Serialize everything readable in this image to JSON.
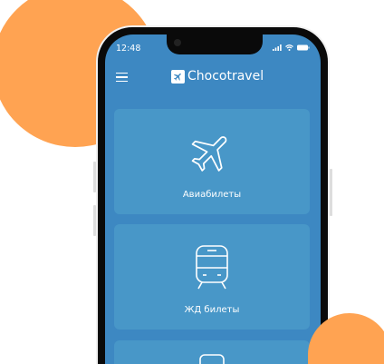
{
  "status_bar": {
    "time": "12:48"
  },
  "header": {
    "brand": "Chocotravel"
  },
  "cards": [
    {
      "label": "Авиабилеты",
      "icon": "airplane-icon"
    },
    {
      "label": "ЖД билеты",
      "icon": "train-icon"
    },
    {
      "label": "",
      "icon": "bus-icon"
    }
  ],
  "colors": {
    "accent": "#ffa352",
    "screen": "#3d88c2",
    "card": "#4897c8"
  }
}
